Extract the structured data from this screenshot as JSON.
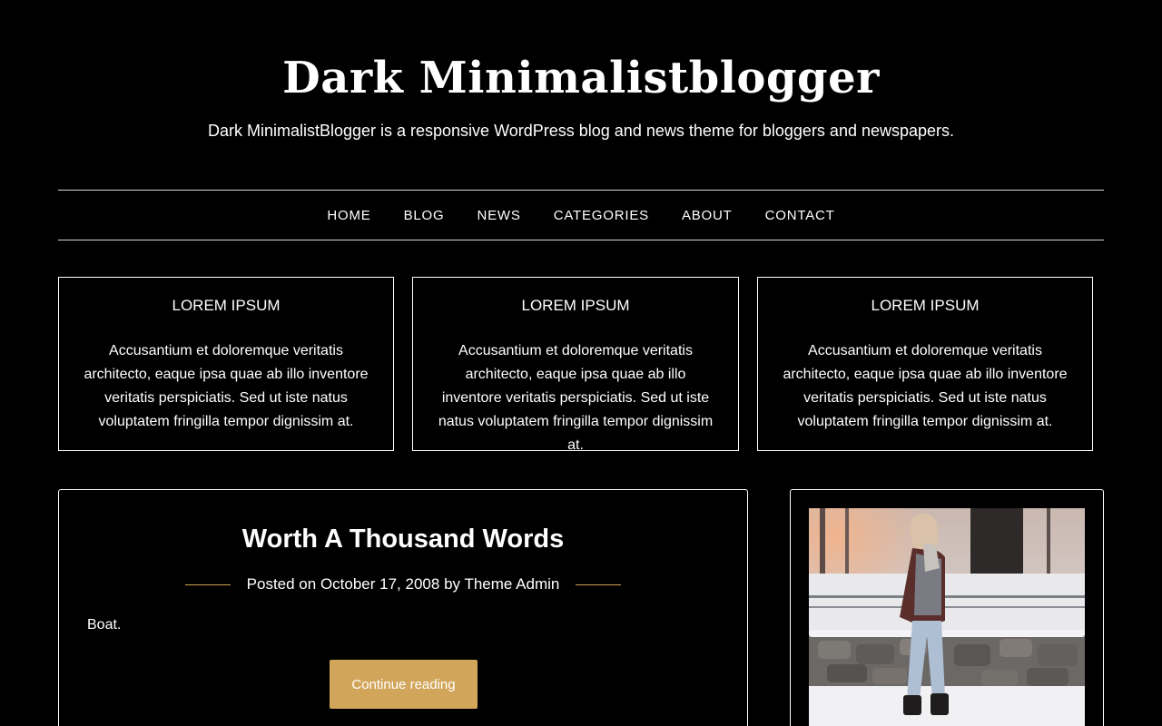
{
  "site": {
    "title": "Dark Minimalistblogger",
    "description": "Dark MinimalistBlogger is a responsive WordPress blog and news theme for bloggers and newspapers."
  },
  "nav": {
    "items": [
      {
        "label": "HOME"
      },
      {
        "label": "BLOG"
      },
      {
        "label": "NEWS"
      },
      {
        "label": "CATEGORIES"
      },
      {
        "label": "ABOUT"
      },
      {
        "label": "CONTACT"
      }
    ]
  },
  "features": [
    {
      "title": "LOREM IPSUM",
      "text": "Accusantium et doloremque veritatis architecto, eaque ipsa quae ab illo inventore veritatis perspiciatis. Sed ut iste natus voluptatem fringilla tempor dignissim at."
    },
    {
      "title": "LOREM IPSUM",
      "text": "Accusantium et doloremque veritatis architecto, eaque ipsa quae ab illo inventore veritatis perspiciatis. Sed ut iste natus voluptatem fringilla tempor dignissim at."
    },
    {
      "title": "LOREM IPSUM",
      "text": "Accusantium et doloremque veritatis architecto, eaque ipsa quae ab illo inventore veritatis perspiciatis. Sed ut iste natus voluptatem fringilla tempor dignissim at."
    }
  ],
  "post": {
    "title": "Worth A Thousand Words",
    "meta_prefix": "Posted on",
    "date": "October 17, 2008",
    "meta_by": "by",
    "author": "Theme Admin",
    "excerpt": "Boat.",
    "continue_label": "Continue reading"
  },
  "colors": {
    "background": "#000000",
    "text": "#ffffff",
    "accent": "#d2a65a",
    "border": "#ffffff"
  },
  "icons": {
    "sidebar_image": "photo-woman-snow"
  }
}
